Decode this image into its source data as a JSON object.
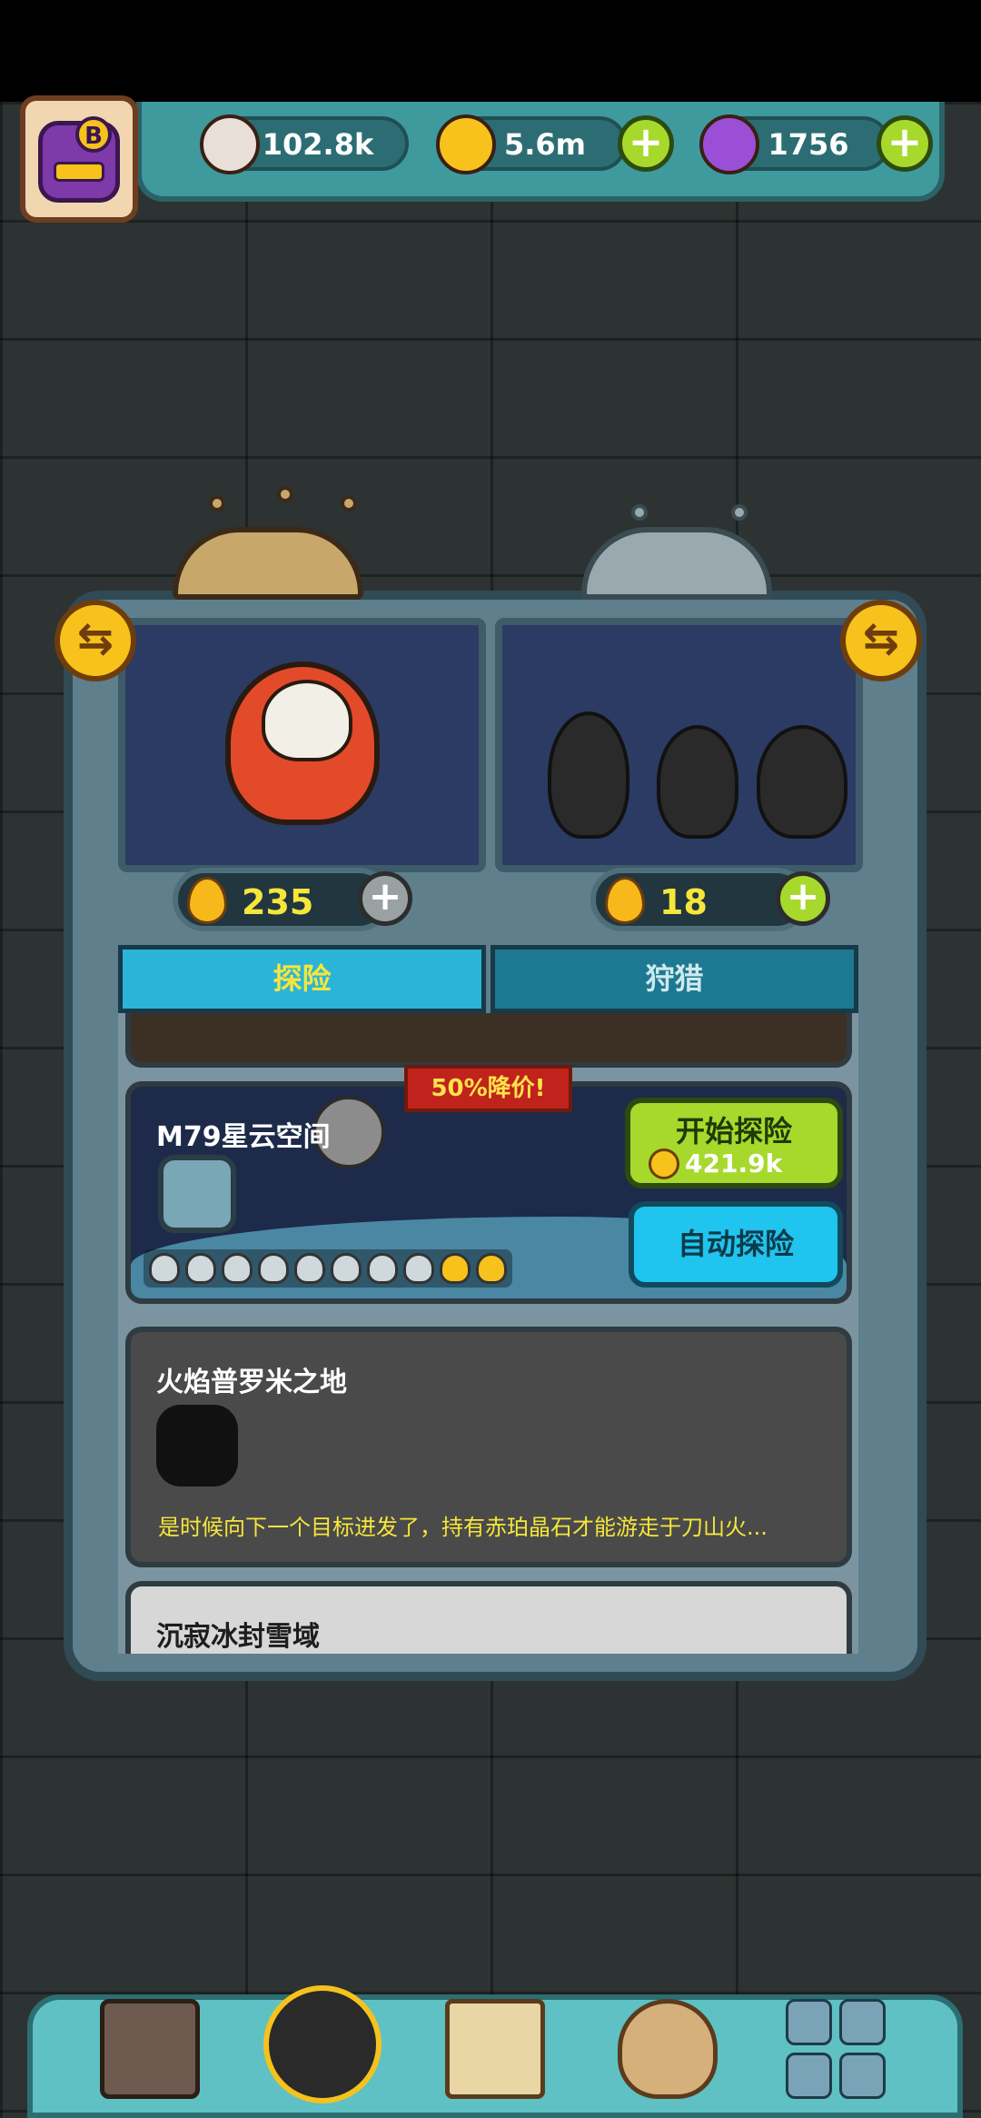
{
  "resources": {
    "eyes": {
      "icon": "eyeball-icon",
      "value": "102.8k"
    },
    "coins": {
      "icon": "coin-icon",
      "value": "5.6m"
    },
    "potions": {
      "icon": "potion-icon",
      "value": "1756"
    }
  },
  "avatar": {
    "badge": "B"
  },
  "drops": {
    "left": "235",
    "right": "18"
  },
  "tabs": {
    "explore": "探险",
    "hunt": "狩猎"
  },
  "stages": [
    {
      "title": "M79星云空间",
      "discount": "50%降价!",
      "start_label": "开始探险",
      "cost": "421.9k",
      "auto_label": "自动探险"
    },
    {
      "title": "火焰普罗米之地",
      "description": "是时候向下一个目标进发了，持有赤珀晶石才能游走于刀山火..."
    },
    {
      "title": "沉寂冰封雪域"
    }
  ],
  "colors": {
    "accent_green": "#a6d92b",
    "accent_blue": "#1fc4ef",
    "gold": "#f6c21b"
  }
}
